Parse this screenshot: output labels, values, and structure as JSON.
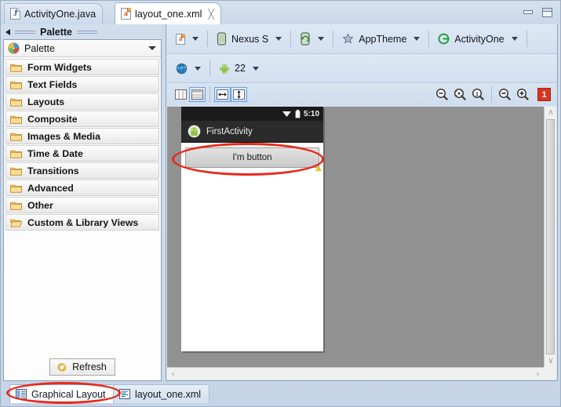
{
  "window": {
    "minimize_title": "Minimize",
    "maximize_title": "Maximize"
  },
  "editor_tabs": [
    {
      "label": "ActivityOne.java",
      "icon": "java-file-icon",
      "glyph": "J",
      "active": false,
      "closable": false
    },
    {
      "label": "layout_one.xml",
      "icon": "xml-file-icon",
      "glyph": "a",
      "active": true,
      "closable": true,
      "close_glyph": "╳"
    }
  ],
  "palette": {
    "view_header_title": "Palette",
    "collapse_icon": "left-arrow-icon",
    "combo_label": "Palette",
    "combo_icon": "palette-icon",
    "combo_chevron": "chevron-down-icon",
    "items": [
      {
        "label": "Form Widgets",
        "icon": "folder-icon"
      },
      {
        "label": "Text Fields",
        "icon": "folder-icon"
      },
      {
        "label": "Layouts",
        "icon": "folder-icon"
      },
      {
        "label": "Composite",
        "icon": "folder-icon"
      },
      {
        "label": "Images & Media",
        "icon": "folder-icon"
      },
      {
        "label": "Time & Date",
        "icon": "folder-icon"
      },
      {
        "label": "Transitions",
        "icon": "folder-icon"
      },
      {
        "label": "Advanced",
        "icon": "folder-icon"
      },
      {
        "label": "Other",
        "icon": "folder-icon"
      },
      {
        "label": "Custom & Library Views",
        "icon": "open-folder-icon"
      }
    ],
    "refresh_label": "Refresh",
    "refresh_icon": "refresh-icon"
  },
  "config_toolbar": {
    "row1": [
      {
        "name": "configuration-chooser",
        "label": "",
        "icon": "xml-config-icon",
        "dropdown": true
      },
      {
        "name": "device-chooser",
        "label": "Nexus S",
        "icon": "device-icon",
        "dropdown": true
      },
      {
        "name": "orientation-chooser",
        "label": "",
        "icon": "orientation-portrait-icon",
        "dropdown": true
      },
      {
        "name": "theme-chooser",
        "label": "AppTheme",
        "icon": "theme-star-icon",
        "dropdown": true
      },
      {
        "name": "activity-chooser",
        "label": "ActivityOne",
        "icon": "activity-icon",
        "dropdown": true
      }
    ],
    "row2": [
      {
        "name": "locale-chooser",
        "label": "",
        "icon": "globe-icon",
        "dropdown": true
      },
      {
        "name": "api-level-chooser",
        "label": "22",
        "icon": "android-icon",
        "dropdown": true
      }
    ]
  },
  "view_toolbar": {
    "left_buttons": [
      {
        "name": "show-included-toggle",
        "icon": "columns-icon",
        "selected": false
      },
      {
        "name": "outline-toggle",
        "icon": "rows-icon",
        "selected": true
      },
      {
        "name": "fit-width-toggle",
        "icon": "horizontal-arrows-icon",
        "selected": true
      },
      {
        "name": "fit-height-toggle",
        "icon": "vertical-arrows-icon",
        "selected": true
      }
    ],
    "zoom_buttons": [
      {
        "name": "zoom-out-button",
        "icon": "zoom-out-icon"
      },
      {
        "name": "zoom-fit-button",
        "icon": "zoom-fit-icon"
      },
      {
        "name": "zoom-actual-size-button",
        "icon": "zoom-actual-icon",
        "label": "1"
      },
      {
        "name": "zoom-decrease-button",
        "icon": "magnifier-minus-icon"
      },
      {
        "name": "zoom-increase-button",
        "icon": "magnifier-plus-icon"
      }
    ],
    "issue_badge": {
      "count": "1",
      "color": "#d9341f"
    }
  },
  "preview": {
    "status_bar": {
      "clock": "5:10",
      "wifi_icon": "wifi-icon",
      "battery_icon": "battery-icon"
    },
    "action_bar": {
      "title": "FirstActivity",
      "icon": "android-app-icon"
    },
    "widgets": [
      {
        "type": "Button",
        "text": "I'm button",
        "has_warning": true,
        "warning_icon": "warning-icon"
      }
    ],
    "canvas_color": "#919191"
  },
  "annotations": [
    {
      "name": "button-highlight-ellipse",
      "color": "#e8281c",
      "shape": "ellipse"
    },
    {
      "name": "graphical-layout-tab-highlight-ellipse",
      "color": "#e8281c",
      "shape": "ellipse"
    }
  ],
  "bottom_tabs": [
    {
      "label": "Graphical Layout",
      "icon": "graphical-layout-icon",
      "active": true
    },
    {
      "label": "layout_one.xml",
      "icon": "xml-source-icon",
      "active": false
    }
  ],
  "scrollbars": {
    "vertical": {
      "up_glyph": "∧",
      "down_glyph": "∨"
    },
    "horizontal": {
      "left_glyph": "‹",
      "right_glyph": "›"
    }
  }
}
